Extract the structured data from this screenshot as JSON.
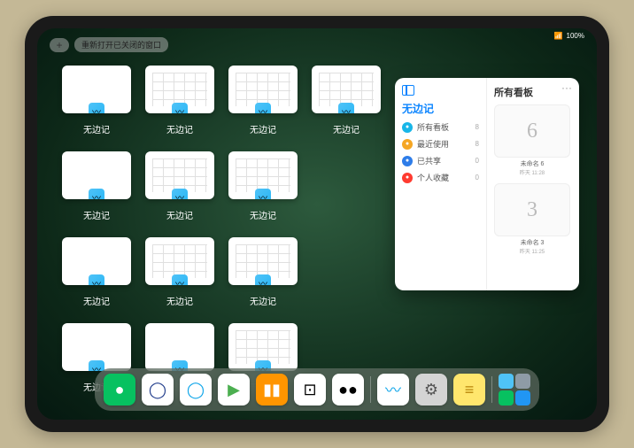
{
  "status": {
    "battery": "100%",
    "wifi": "📶"
  },
  "topControls": {
    "plus": "+",
    "reopenLabel": "重新打开已关闭的窗口"
  },
  "appSwitcher": {
    "thumbLabel": "无边记",
    "thumbs": [
      {
        "variant": "blank"
      },
      {
        "variant": "grid"
      },
      {
        "variant": "grid"
      },
      {
        "variant": "grid"
      },
      {
        "variant": "blank"
      },
      {
        "variant": "grid"
      },
      {
        "variant": "grid"
      },
      {
        "variant": "blank"
      },
      {
        "variant": "grid"
      },
      {
        "variant": "grid"
      },
      {
        "variant": "blank"
      },
      {
        "variant": "blank"
      },
      {
        "variant": "grid"
      }
    ]
  },
  "popup": {
    "leftTitle": "无边记",
    "rightTitle": "所有看板",
    "moreGlyph": "···",
    "items": [
      {
        "icon": "grid",
        "label": "所有看板",
        "count": "8",
        "color": "#18b6e8"
      },
      {
        "icon": "clock",
        "label": "最近使用",
        "count": "8",
        "color": "#f5a623"
      },
      {
        "icon": "person",
        "label": "已共享",
        "count": "0",
        "color": "#2e7de9"
      },
      {
        "icon": "heart",
        "label": "个人收藏",
        "count": "0",
        "color": "#ff3b30"
      }
    ],
    "boards": [
      {
        "glyph": "6",
        "name": "未命名 6",
        "sub": "昨天 11:28"
      },
      {
        "glyph": "3",
        "name": "未命名 3",
        "sub": "昨天 11:25"
      }
    ]
  },
  "dock": {
    "apps": [
      {
        "name": "wechat",
        "bg": "#07c160",
        "glyph": "●"
      },
      {
        "name": "quark-hd",
        "bg": "#ffffff",
        "glyph": "◯",
        "fg": "#1e3a8a"
      },
      {
        "name": "quark",
        "bg": "#ffffff",
        "glyph": "◯",
        "fg": "#0ea5e9"
      },
      {
        "name": "play",
        "bg": "#ffffff",
        "glyph": "▶",
        "fg": "#4caf50"
      },
      {
        "name": "books",
        "bg": "#ff9500",
        "glyph": "▮▮",
        "fg": "#fff"
      },
      {
        "name": "dice",
        "bg": "#ffffff",
        "glyph": "⊡",
        "fg": "#000"
      },
      {
        "name": "himalaya",
        "bg": "#ffffff",
        "glyph": "●●",
        "fg": "#000"
      }
    ],
    "apps2": [
      {
        "name": "freeform",
        "bg": "#ffffff",
        "glyph": "〰",
        "fg": "#0ea5e9"
      },
      {
        "name": "settings",
        "bg": "#d4d4d4",
        "glyph": "⚙",
        "fg": "#555"
      },
      {
        "name": "notes",
        "bg": "#ffe66d",
        "glyph": "≡",
        "fg": "#b8860b"
      }
    ],
    "recents": [
      {
        "c": "#4fc3f7"
      },
      {
        "c": "#8e9ba6"
      },
      {
        "c": "#07c160"
      },
      {
        "c": "#2196f3"
      }
    ]
  }
}
